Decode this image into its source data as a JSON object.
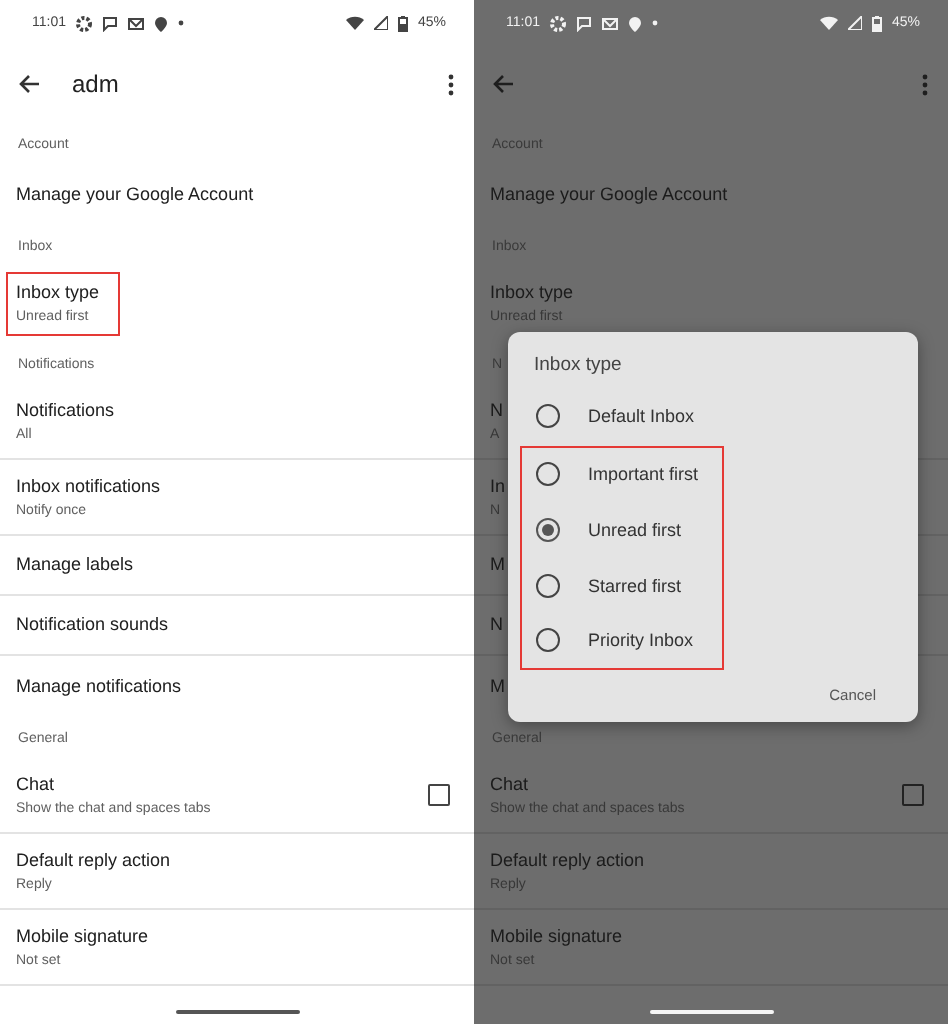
{
  "screens": [
    {
      "dimmed": false,
      "status_bar": {
        "time": "11:01",
        "battery": "45%"
      },
      "app_bar": {
        "title": "adm"
      },
      "settings": [
        {
          "kind": "header",
          "title": "Account"
        },
        {
          "kind": "item",
          "title": "Manage your Google Account",
          "highlighted": false
        },
        {
          "kind": "header",
          "title": "Inbox"
        },
        {
          "kind": "item",
          "title": "Inbox type",
          "subtitle": "Unread first",
          "highlighted": true
        },
        {
          "kind": "header",
          "title": "Notifications"
        },
        {
          "kind": "item",
          "title": "Notifications",
          "subtitle": "All",
          "highlighted": false
        },
        {
          "kind": "item",
          "title": "Inbox notifications",
          "subtitle": "Notify once",
          "highlighted": false
        },
        {
          "kind": "item",
          "title": "Manage labels",
          "highlighted": false
        },
        {
          "kind": "item",
          "title": "Notification sounds",
          "highlighted": false
        },
        {
          "kind": "item",
          "title": "Manage notifications",
          "highlighted": false
        },
        {
          "kind": "header",
          "title": "General"
        },
        {
          "kind": "checkbox",
          "title": "Chat",
          "subtitle": "Show the chat and spaces tabs",
          "checked": false,
          "highlighted": false
        },
        {
          "kind": "item",
          "title": "Default reply action",
          "subtitle": "Reply",
          "highlighted": false
        },
        {
          "kind": "item",
          "title": "Mobile signature",
          "subtitle": "Not set",
          "highlighted": false
        }
      ]
    },
    {
      "dimmed": true,
      "status_bar": {
        "time": "11:01",
        "battery": "45%"
      },
      "settings": [
        {
          "kind": "header",
          "title": "Account"
        },
        {
          "kind": "item",
          "title": "Manage your Google Account",
          "highlighted": false
        },
        {
          "kind": "header",
          "title": "Inbox"
        },
        {
          "kind": "item",
          "title": "Inbox type",
          "subtitle": "Unread first",
          "highlighted": false
        },
        {
          "kind": "header",
          "title": "N"
        },
        {
          "kind": "item",
          "title": "N",
          "subtitle": "A",
          "highlighted": false
        },
        {
          "kind": "item",
          "title": "In",
          "subtitle": "N",
          "highlighted": false
        },
        {
          "kind": "item",
          "title": "M",
          "highlighted": false
        },
        {
          "kind": "item",
          "title": "N",
          "highlighted": false
        },
        {
          "kind": "item",
          "title": "M",
          "highlighted": false
        },
        {
          "kind": "header",
          "title": "General"
        },
        {
          "kind": "checkbox",
          "title": "Chat",
          "subtitle": "Show the chat and spaces tabs",
          "checked": false,
          "highlighted": false
        },
        {
          "kind": "item",
          "title": "Default reply action",
          "subtitle": "Reply",
          "highlighted": false
        },
        {
          "kind": "item",
          "title": "Mobile signature",
          "subtitle": "Not set",
          "highlighted": false
        }
      ],
      "dialog": {
        "title": "Inbox type",
        "options": [
          {
            "label": "Default Inbox",
            "selected": false,
            "highlighted": false
          },
          {
            "label": "Important first",
            "selected": false,
            "highlighted": true
          },
          {
            "label": "Unread first",
            "selected": true,
            "highlighted": true
          },
          {
            "label": "Starred first",
            "selected": false,
            "highlighted": true
          },
          {
            "label": "Priority Inbox",
            "selected": false,
            "highlighted": true
          }
        ],
        "cancel": "Cancel"
      }
    }
  ]
}
